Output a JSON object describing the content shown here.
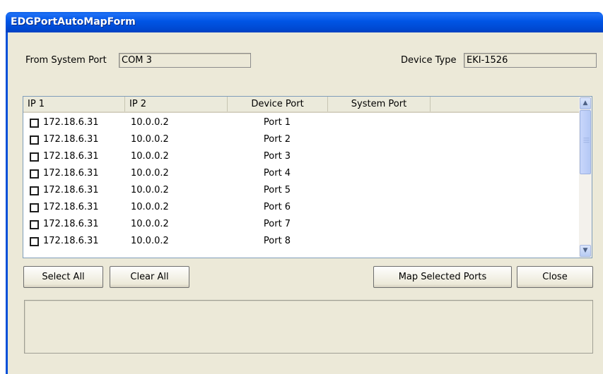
{
  "window": {
    "title": "EDGPortAutoMapForm"
  },
  "form": {
    "from_system_port_label": "From System Port",
    "from_system_port_value": "COM 3",
    "device_type_label": "Device Type",
    "device_type_value": "EKI-1526"
  },
  "list": {
    "columns": [
      "IP 1",
      "IP 2",
      "Device Port",
      "System Port",
      ""
    ],
    "rows": [
      {
        "checked": false,
        "ip1": "172.18.6.31",
        "ip2": "10.0.0.2",
        "device_port": "Port 1",
        "system_port": ""
      },
      {
        "checked": false,
        "ip1": "172.18.6.31",
        "ip2": "10.0.0.2",
        "device_port": "Port 2",
        "system_port": ""
      },
      {
        "checked": false,
        "ip1": "172.18.6.31",
        "ip2": "10.0.0.2",
        "device_port": "Port 3",
        "system_port": ""
      },
      {
        "checked": false,
        "ip1": "172.18.6.31",
        "ip2": "10.0.0.2",
        "device_port": "Port 4",
        "system_port": ""
      },
      {
        "checked": false,
        "ip1": "172.18.6.31",
        "ip2": "10.0.0.2",
        "device_port": "Port 5",
        "system_port": ""
      },
      {
        "checked": false,
        "ip1": "172.18.6.31",
        "ip2": "10.0.0.2",
        "device_port": "Port 6",
        "system_port": ""
      },
      {
        "checked": false,
        "ip1": "172.18.6.31",
        "ip2": "10.0.0.2",
        "device_port": "Port 7",
        "system_port": ""
      },
      {
        "checked": false,
        "ip1": "172.18.6.31",
        "ip2": "10.0.0.2",
        "device_port": "Port 8",
        "system_port": ""
      }
    ],
    "scroll_up_icon": "chevron-up-icon",
    "scroll_down_icon": "chevron-down-icon"
  },
  "buttons": {
    "select_all": "Select All",
    "clear_all": "Clear All",
    "map_selected": "Map Selected Ports",
    "close": "Close"
  },
  "status": {
    "text": ""
  },
  "colors": {
    "titlebar": "#0055e5",
    "client": "#ece9d8",
    "frame": "#0050d8"
  }
}
